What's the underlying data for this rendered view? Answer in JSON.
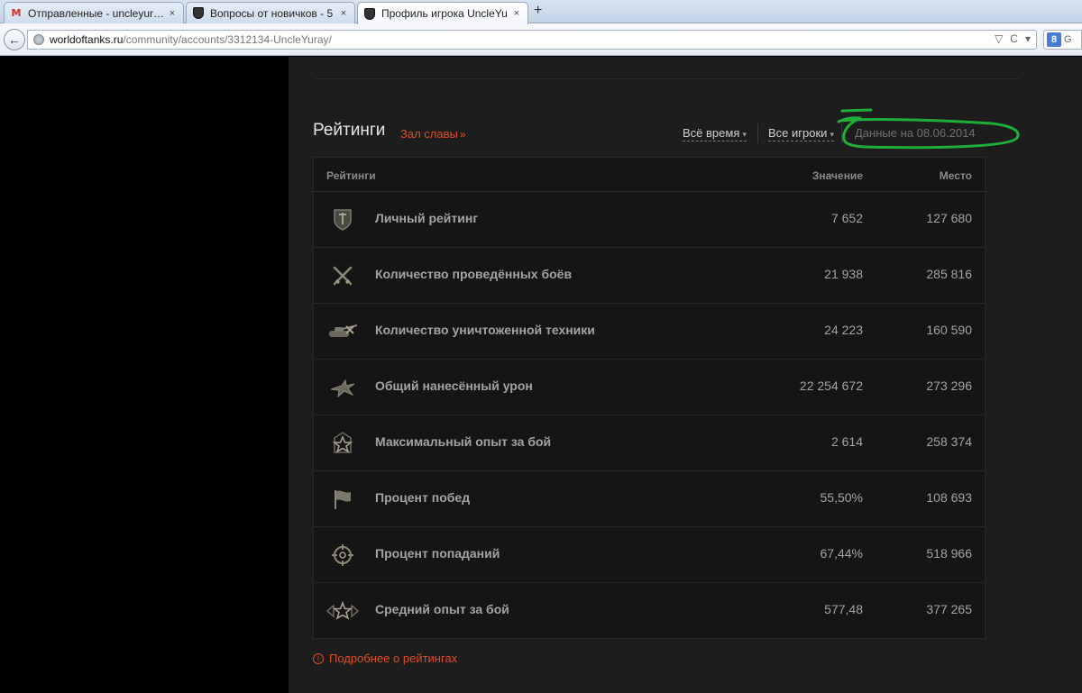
{
  "browser": {
    "tabs": [
      {
        "title": "Отправленные - uncleyur…",
        "icon": "gmail-icon",
        "active": false
      },
      {
        "title": "Вопросы от новичков - 5 …",
        "icon": "wot-icon",
        "active": false
      },
      {
        "title": "Профиль игрока UncleYu…",
        "icon": "wot-icon",
        "active": true
      }
    ],
    "new_tab": "+",
    "close_glyph": "×",
    "back_glyph": "←",
    "url_domain": "worldoftanks.ru",
    "url_path": "/community/accounts/3312134-UncleYuray/",
    "url_actions": [
      "▽",
      "C",
      "▾"
    ],
    "search_engine": "8",
    "search_placeholder": "G"
  },
  "ratings": {
    "title": "Рейтинги",
    "hall_of_fame": "Зал славы",
    "hall_arrow": "»",
    "filter_time": "Всё время",
    "filter_players": "Все игроки",
    "caret": "▾",
    "date_note": "Данные на 08.06.2014",
    "columns": {
      "name": "Рейтинги",
      "value": "Значение",
      "place": "Место"
    },
    "rows": [
      {
        "icon": "shield-icon",
        "label": "Личный рейтинг",
        "value": "7 652",
        "place": "127 680"
      },
      {
        "icon": "crossed-swords-icon",
        "label": "Количество проведённых боёв",
        "value": "21 938",
        "place": "285 816"
      },
      {
        "icon": "destroyed-tank-icon",
        "label": "Количество уничтоженной техники",
        "value": "24 223",
        "place": "160 590"
      },
      {
        "icon": "damage-explosion-icon",
        "label": "Общий нанесённый урон",
        "value": "22 254 672",
        "place": "273 296"
      },
      {
        "icon": "star-badge-icon",
        "label": "Максимальный опыт за бой",
        "value": "2 614",
        "place": "258 374"
      },
      {
        "icon": "flag-icon",
        "label": "Процент побед",
        "value": "55,50%",
        "place": "108 693"
      },
      {
        "icon": "crosshair-icon",
        "label": "Процент попаданий",
        "value": "67,44%",
        "place": "518 966"
      },
      {
        "icon": "winged-star-icon",
        "label": "Средний опыт за бой",
        "value": "577,48",
        "place": "377 265"
      }
    ],
    "more_link": "Подробнее о рейтингах",
    "info_glyph": "!"
  },
  "colors": {
    "accent": "#e34b22",
    "annotation": "#1fae3a",
    "panel_bg": "#1d1d1d"
  }
}
